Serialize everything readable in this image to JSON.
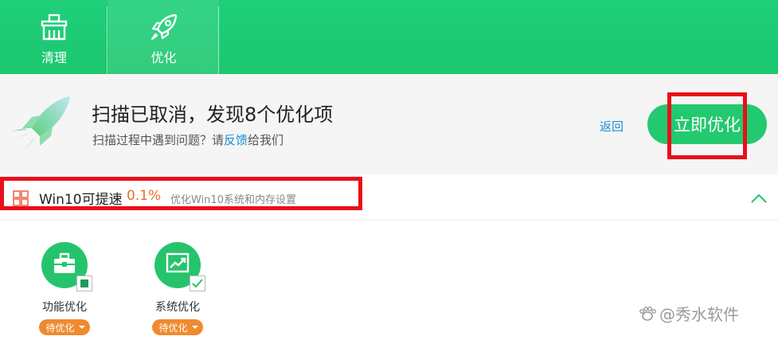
{
  "toolbar": {
    "tabs": [
      {
        "label": "清理",
        "icon": "broom-icon"
      },
      {
        "label": "优化",
        "icon": "rocket-icon"
      }
    ]
  },
  "status": {
    "title": "扫描已取消，发现8个优化项",
    "sub_prefix": "扫描过程中遇到问题？请",
    "sub_link": "反馈",
    "sub_suffix": "给我们",
    "back_label": "返回",
    "primary_label": "立即优化"
  },
  "section": {
    "title": "Win10可提速",
    "percent": "0.1%",
    "description": "优化Win10系统和内存设置"
  },
  "items": [
    {
      "label": "功能优化",
      "status": "待优化",
      "icon": "toolbox-icon",
      "checkbox": "partial"
    },
    {
      "label": "系统优化",
      "status": "待优化",
      "icon": "chart-icon",
      "checkbox": "checked"
    }
  ],
  "watermark": "@秀水软件",
  "colors": {
    "brand_green": "#1fcf7a",
    "highlight_red": "#e8101a",
    "link_blue": "#1a8fd8",
    "accent_orange": "#ef6a1f"
  }
}
